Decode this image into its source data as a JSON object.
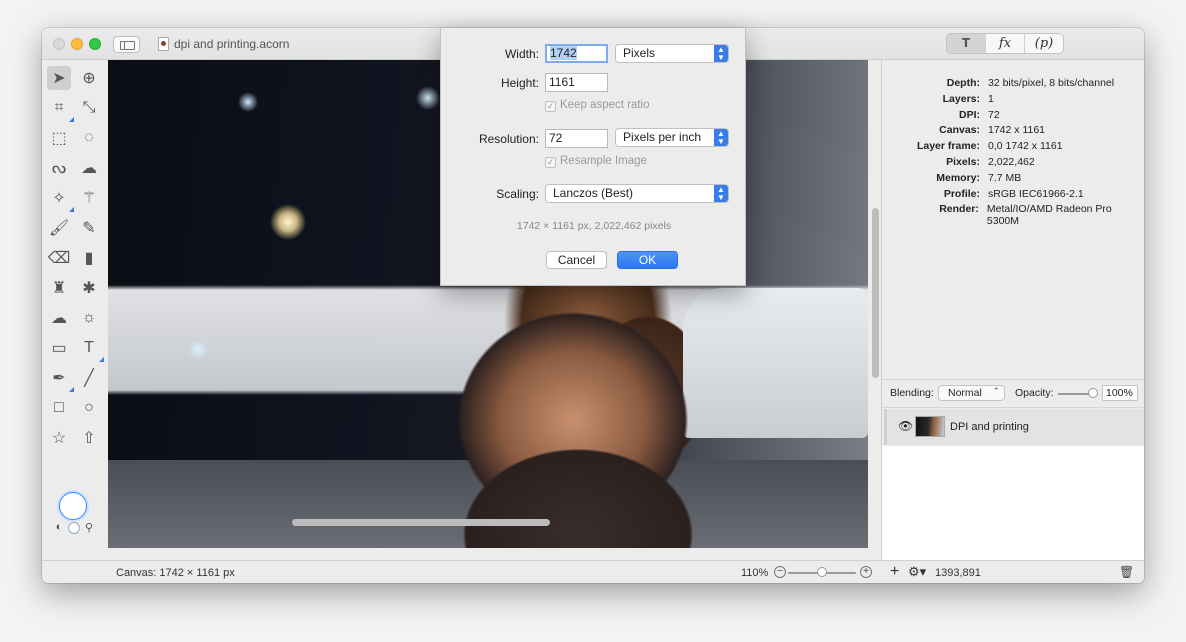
{
  "window": {
    "document_title": "dpi and printing.acorn"
  },
  "palette_tabs": [
    "T",
    "fx",
    "(p)"
  ],
  "dialog": {
    "width_label": "Width:",
    "width_value": "1742",
    "width_unit": "Pixels",
    "height_label": "Height:",
    "height_value": "1161",
    "keep_aspect_label": "Keep aspect ratio",
    "resolution_label": "Resolution:",
    "resolution_value": "72",
    "resolution_unit": "Pixels per inch",
    "resample_label": "Resample Image",
    "scaling_label": "Scaling:",
    "scaling_value": "Lanczos (Best)",
    "summary": "1742 × 1161 px, 2,022,462 pixels",
    "cancel_label": "Cancel",
    "ok_label": "OK"
  },
  "info": {
    "depth_label": "Depth:",
    "depth_value": "32 bits/pixel, 8 bits/channel",
    "layers_label": "Layers:",
    "layers_value": "1",
    "dpi_label": "DPI:",
    "dpi_value": "72",
    "canvas_label": "Canvas:",
    "canvas_value": "1742 x 1161",
    "layer_frame_label": "Layer frame:",
    "layer_frame_value": "0,0 1742 x 1161",
    "pixels_label": "Pixels:",
    "pixels_value": "2,022,462",
    "memory_label": "Memory:",
    "memory_value": "7.7 MB",
    "profile_label": "Profile:",
    "profile_value": "sRGB IEC61966-2.1",
    "render_label": "Render:",
    "render_value": "Metal/IO/AMD Radeon Pro 5300M"
  },
  "layer_controls": {
    "blending_label": "Blending:",
    "blending_value": "Normal",
    "opacity_label": "Opacity:",
    "opacity_value": "100%"
  },
  "layers": [
    {
      "name": "DPI and printing"
    }
  ],
  "status": {
    "canvas_info": "Canvas: 1742 × 1161 px",
    "zoom": "110%",
    "coords": "1393,891"
  },
  "colors": {
    "accent": "#3b7de6"
  }
}
